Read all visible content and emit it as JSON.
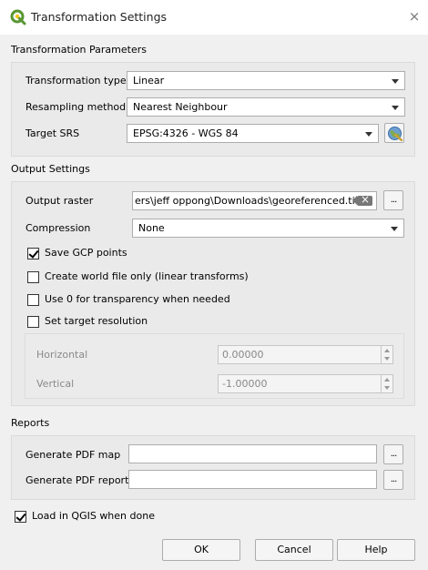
{
  "window": {
    "title": "Transformation Settings",
    "close_glyph": "×"
  },
  "transformation": {
    "section_title": "Transformation Parameters",
    "type_label": "Transformation type",
    "type_value": "Linear",
    "resampling_label": "Resampling method",
    "resampling_value": "Nearest Neighbour",
    "srs_label": "Target SRS",
    "srs_value": "EPSG:4326 - WGS 84"
  },
  "output": {
    "section_title": "Output Settings",
    "raster_label": "Output raster",
    "raster_value": "ers\\jeff oppong\\Downloads\\georeferenced.tif",
    "browse_label": "...",
    "compression_label": "Compression",
    "compression_value": "None",
    "save_gcp_label": "Save GCP points",
    "save_gcp_checked": true,
    "world_file_label": "Create world file only (linear transforms)",
    "world_file_checked": false,
    "transparency_label": "Use 0 for transparency when needed",
    "transparency_checked": false,
    "target_res_label": "Set target resolution",
    "target_res_checked": false,
    "horizontal_label": "Horizontal",
    "horizontal_value": "0.00000",
    "vertical_label": "Vertical",
    "vertical_value": "-1.00000"
  },
  "reports": {
    "section_title": "Reports",
    "pdf_map_label": "Generate PDF map",
    "pdf_map_value": "",
    "pdf_report_label": "Generate PDF report",
    "pdf_report_value": "",
    "browse_label": "..."
  },
  "load_in_qgis": {
    "label": "Load in QGIS when done",
    "checked": true
  },
  "buttons": {
    "ok": "OK",
    "cancel": "Cancel",
    "help": "Help"
  },
  "colors": {
    "brand_green": "#589632",
    "dialog_background": "#f0f0f0",
    "section_background": "#eaeaea"
  },
  "icons": {
    "app_logo": "qgis-logo-icon",
    "close": "close-icon",
    "dropdown": "chevron-down-icon",
    "crs_selector": "globe-crs-icon",
    "clear": "clear-text-icon",
    "spin": "spinbox-arrows-icon"
  }
}
